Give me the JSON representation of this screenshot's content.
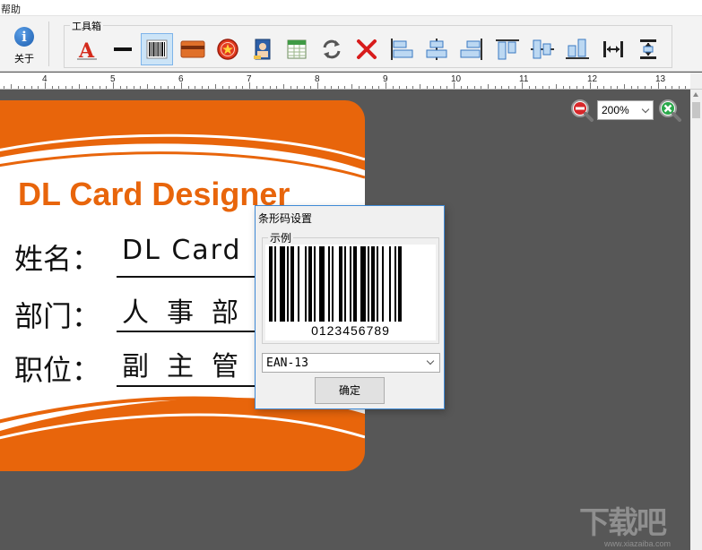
{
  "menubar": {
    "help": "帮助"
  },
  "toolbar": {
    "about_label": "关于",
    "toolbox_title": "工具箱",
    "tools": [
      {
        "icon": "text-icon",
        "active": false
      },
      {
        "icon": "line-icon",
        "active": false
      },
      {
        "icon": "barcode-icon",
        "active": true
      },
      {
        "icon": "rectangle-icon",
        "active": false
      },
      {
        "icon": "stamp-icon",
        "active": false
      },
      {
        "icon": "photo-icon",
        "active": false
      },
      {
        "icon": "table-icon",
        "active": false
      },
      {
        "icon": "refresh-icon",
        "active": false
      },
      {
        "icon": "delete-icon",
        "active": false
      },
      {
        "icon": "align-left-icon",
        "active": false
      },
      {
        "icon": "align-center-icon",
        "active": false
      },
      {
        "icon": "align-right-icon",
        "active": false
      },
      {
        "icon": "align-top-icon",
        "active": false
      },
      {
        "icon": "align-middle-icon",
        "active": false
      },
      {
        "icon": "align-bottom-icon",
        "active": false
      },
      {
        "icon": "same-width-icon",
        "active": false
      },
      {
        "icon": "same-height-icon",
        "active": false
      }
    ]
  },
  "ruler": {
    "labels": [
      "4",
      "5",
      "6",
      "7",
      "8",
      "9",
      "10",
      "11",
      "12",
      "13"
    ]
  },
  "card": {
    "title": "DL Card Designer",
    "fields": [
      {
        "label": "姓名：",
        "value": "DL Card"
      },
      {
        "label": "部门：",
        "value": "人事部"
      },
      {
        "label": "职位：",
        "value": "副主管"
      }
    ]
  },
  "zoom": {
    "value": "200%"
  },
  "barcode_dialog": {
    "title": "条形码设置",
    "sample_label": "示例",
    "digits": "0123456789",
    "type": "EAN-13",
    "ok_label": "确定"
  },
  "watermark": {
    "brand": "下载吧",
    "url": "www.xiazaiba.com"
  },
  "colors": {
    "accent": "#e8650b",
    "canvas": "#575757",
    "dialog_border": "#3f8ad6"
  }
}
